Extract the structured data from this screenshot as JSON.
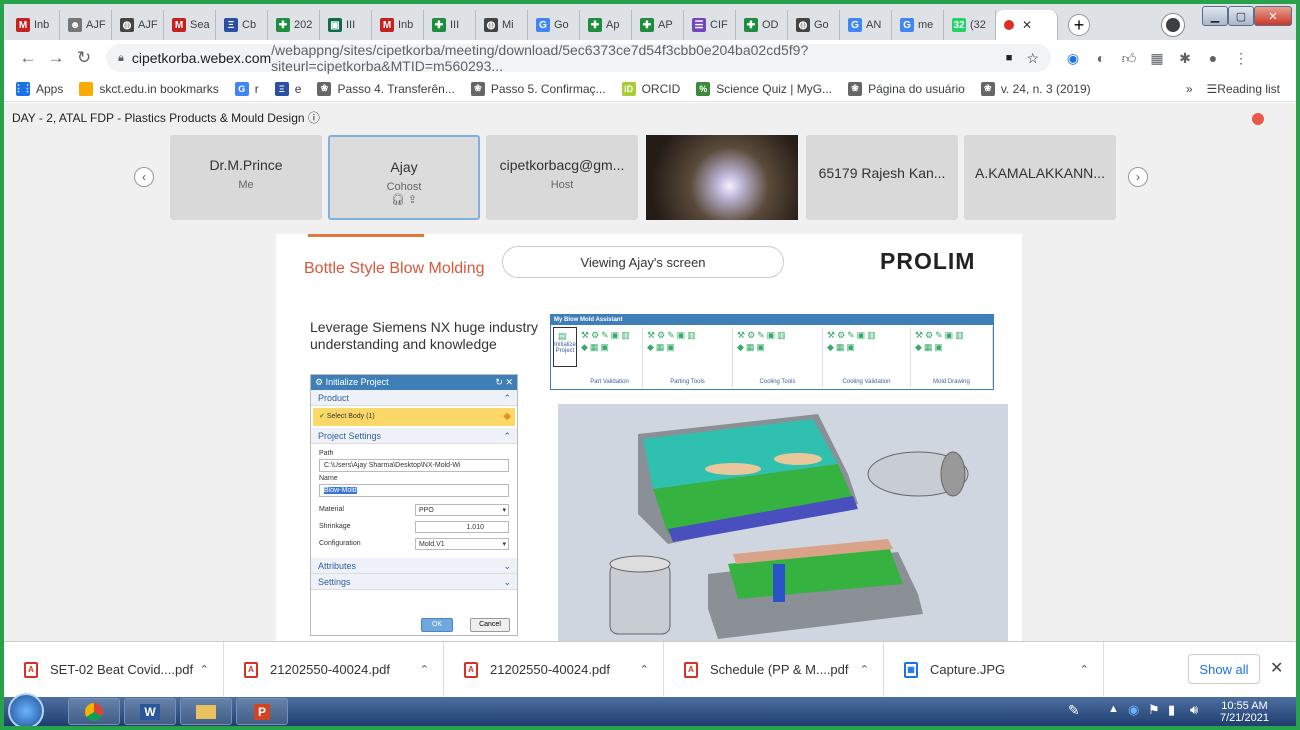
{
  "tabs": [
    {
      "label": "Inb",
      "icon": "gmail-icon",
      "color": "#c5221f",
      "glyph": "M"
    },
    {
      "label": "AJF",
      "icon": "person-icon",
      "color": "#777777",
      "glyph": "☻"
    },
    {
      "label": "AJF",
      "icon": "webex-icon",
      "color": "#444444",
      "glyph": "◍"
    },
    {
      "label": "Sea",
      "icon": "gmail-icon",
      "color": "#c5221f",
      "glyph": "M"
    },
    {
      "label": "Cb",
      "icon": "portal-icon",
      "color": "#2b4fa3",
      "glyph": "Ξ"
    },
    {
      "label": "202",
      "icon": "classroom-icon",
      "color": "#1e8e3e",
      "glyph": "✚"
    },
    {
      "label": "III",
      "icon": "meet-icon",
      "color": "#0f6b4a",
      "glyph": "▣"
    },
    {
      "label": "Inb",
      "icon": "gmail-icon",
      "color": "#c5221f",
      "glyph": "M"
    },
    {
      "label": "III",
      "icon": "classroom-icon",
      "color": "#1e8e3e",
      "glyph": "✚"
    },
    {
      "label": "Mi",
      "icon": "webex-icon",
      "color": "#444444",
      "glyph": "◍"
    },
    {
      "label": "Go",
      "icon": "google-icon",
      "color": "#4285f4",
      "glyph": "G"
    },
    {
      "label": "Ap",
      "icon": "classroom-icon",
      "color": "#1e8e3e",
      "glyph": "✚"
    },
    {
      "label": "AP",
      "icon": "classroom-icon",
      "color": "#1e8e3e",
      "glyph": "✚"
    },
    {
      "label": "CIF",
      "icon": "forms-icon",
      "color": "#7248b9",
      "glyph": "☰"
    },
    {
      "label": "OD",
      "icon": "classroom-icon",
      "color": "#1e8e3e",
      "glyph": "✚"
    },
    {
      "label": "Go",
      "icon": "webex-icon",
      "color": "#444444",
      "glyph": "◍"
    },
    {
      "label": "AN",
      "icon": "google-icon",
      "color": "#4285f4",
      "glyph": "G"
    },
    {
      "label": "me",
      "icon": "google-icon",
      "color": "#4285f4",
      "glyph": "G"
    },
    {
      "label": "(32",
      "icon": "whatsapp-icon",
      "color": "#25d366",
      "glyph": "32"
    }
  ],
  "active_tab": {
    "label": "",
    "icon": "recording-icon"
  },
  "toolbar": {
    "url_host": "cipetkorba.webex.com",
    "url_path": "/webappng/sites/cipetkorba/meeting/download/5ec6373ce7d54f3cbb0e204ba02cd5f9?siteurl=cipetkorba&MTID=m560293..."
  },
  "bookmarks": [
    {
      "label": "Apps",
      "icon": "apps-grid-icon",
      "color": "#1a73e8",
      "glyph": "⋮⋮"
    },
    {
      "label": "skct.edu.in bookmarks",
      "icon": "folder-icon",
      "color": "#f9ab00",
      "glyph": ""
    },
    {
      "label": "r",
      "icon": "google-icon",
      "color": "#4285f4",
      "glyph": "G"
    },
    {
      "label": "e",
      "icon": "portal-icon",
      "color": "#2b4fa3",
      "glyph": "Ξ"
    },
    {
      "label": "Passo 4. Transferên...",
      "icon": "wiki-icon",
      "color": "#666666",
      "glyph": "❀"
    },
    {
      "label": "Passo 5. Confirmaç...",
      "icon": "wiki-icon",
      "color": "#666666",
      "glyph": "❀"
    },
    {
      "label": "ORCID",
      "icon": "orcid-icon",
      "color": "#a6ce39",
      "glyph": "iD"
    },
    {
      "label": "Science Quiz | MyG...",
      "icon": "quiz-icon",
      "color": "#3c8a3c",
      "glyph": "%"
    },
    {
      "label": "Página do usuário",
      "icon": "wiki-icon",
      "color": "#666666",
      "glyph": "❀"
    },
    {
      "label": "v. 24, n. 3 (2019)",
      "icon": "wiki-icon",
      "color": "#666666",
      "glyph": "❀"
    }
  ],
  "reading_list": "Reading list",
  "meeting": {
    "title": "DAY - 2, ATAL FDP - Plastics Products & Mould Design",
    "participants": [
      {
        "name": "Dr.M.Prince",
        "role": "Me"
      },
      {
        "name": "Ajay",
        "role": "Cohost"
      },
      {
        "name": "cipetkorbacg@gm...",
        "role": "Host"
      },
      {
        "name": "",
        "role": ""
      },
      {
        "name": "65179 Rajesh Kan...",
        "role": ""
      },
      {
        "name": "A.KAMALAKKANN...",
        "role": ""
      }
    ]
  },
  "share": {
    "slide_title": "Bottle Style Blow Molding",
    "viewing": "Viewing Ajay's screen",
    "logo": "PROLIM",
    "lead": "Leverage Siemens NX huge industry understanding and knowledge",
    "assistant_title": "My Blow Mold Assistant",
    "assistant_groups": [
      "Initialize Project",
      "Part Validation",
      "Parting Tools",
      "Cooling Tools",
      "Cooling Validation",
      "Mold Drawing"
    ],
    "dialog": {
      "title": "Initialize Project",
      "product": "Product",
      "select_body": "Select Body (1)",
      "project_settings": "Project Settings",
      "path_label": "Path",
      "path_value": "C:\\Users\\Ajay Sharma\\Desktop\\NX-Mold-Wi",
      "name_label": "Name",
      "name_value": "Blow-Mold",
      "material_label": "Material",
      "material_value": "PPO",
      "shrinkage_label": "Shrinkage",
      "shrinkage_value": "1.010",
      "config_label": "Configuration",
      "config_value": "Mold.V1",
      "attributes": "Attributes",
      "settings": "Settings",
      "ok": "OK",
      "cancel": "Cancel"
    }
  },
  "downloads": [
    "SET-02 Beat Covid....pdf",
    "21202550-40024.pdf",
    "21202550-40024.pdf",
    "Schedule (PP & M....pdf",
    "Capture.JPG"
  ],
  "show_all": "Show all",
  "clock": {
    "time": "10:55 AM",
    "date": "7/21/2021"
  }
}
